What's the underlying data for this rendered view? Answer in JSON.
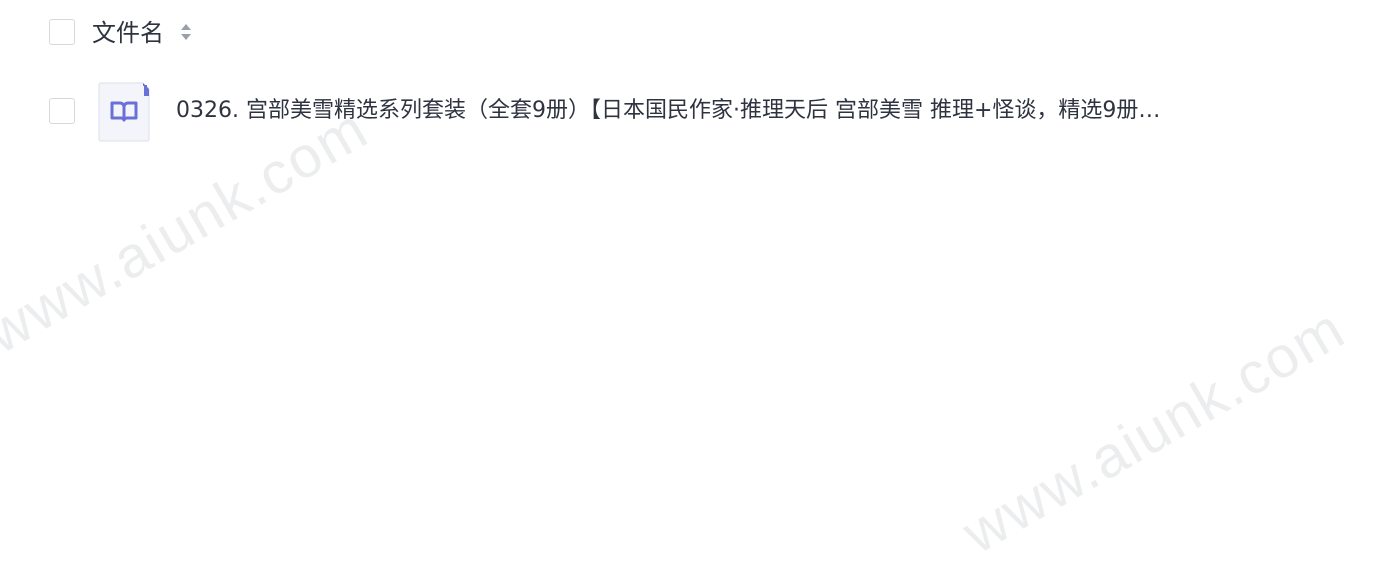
{
  "table_header": {
    "column_label": "文件名",
    "sort_icon": "sort-up-down-icon"
  },
  "rows": [
    {
      "icon": "book-icon",
      "icon_color": "#6b6fd8",
      "name": "0326. 宫部美雪精选系列套装（全套9册）【日本国民作家·推理天后 宫部美雪 推理+怪谈，精选9册…"
    }
  ],
  "watermarks": [
    "www.aiunk.com",
    "www.aiunk.com"
  ]
}
